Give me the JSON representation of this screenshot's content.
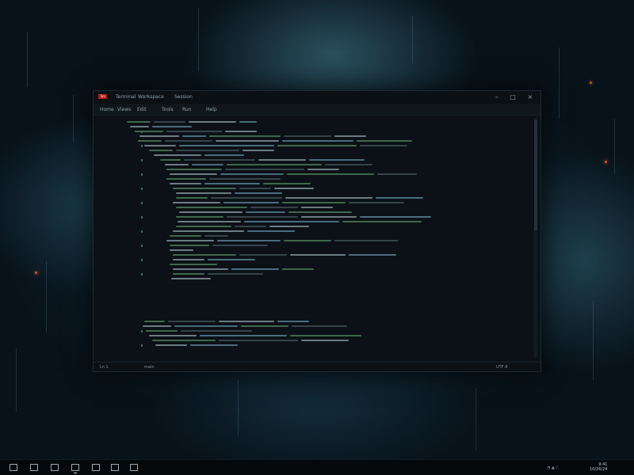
{
  "window": {
    "badge": "Tab",
    "title_items": [
      "Terminal",
      "Workspace",
      "Session"
    ],
    "controls": {
      "minimize": "–",
      "maximize": "□",
      "close": "×"
    }
  },
  "menu": {
    "items": [
      "Home",
      "Views",
      "Edit",
      "Tools",
      "Run",
      "Help"
    ]
  },
  "status": {
    "left": "Ln 1",
    "mid": "main",
    "right": "UTF-8"
  },
  "taskbar": {
    "clock_time": "9:41",
    "clock_date": "10/26/24"
  },
  "colors": {
    "accent": "#b11c18",
    "code_text": "#bfd3dc",
    "code_keyword": "#7fb9d6",
    "code_string": "#6fae7a",
    "code_dim": "#5b6d78"
  },
  "icons": [
    "start-icon",
    "search-icon",
    "taskview-icon",
    "terminal-icon",
    "folder-icon",
    "browser-icon",
    "settings-icon"
  ]
}
